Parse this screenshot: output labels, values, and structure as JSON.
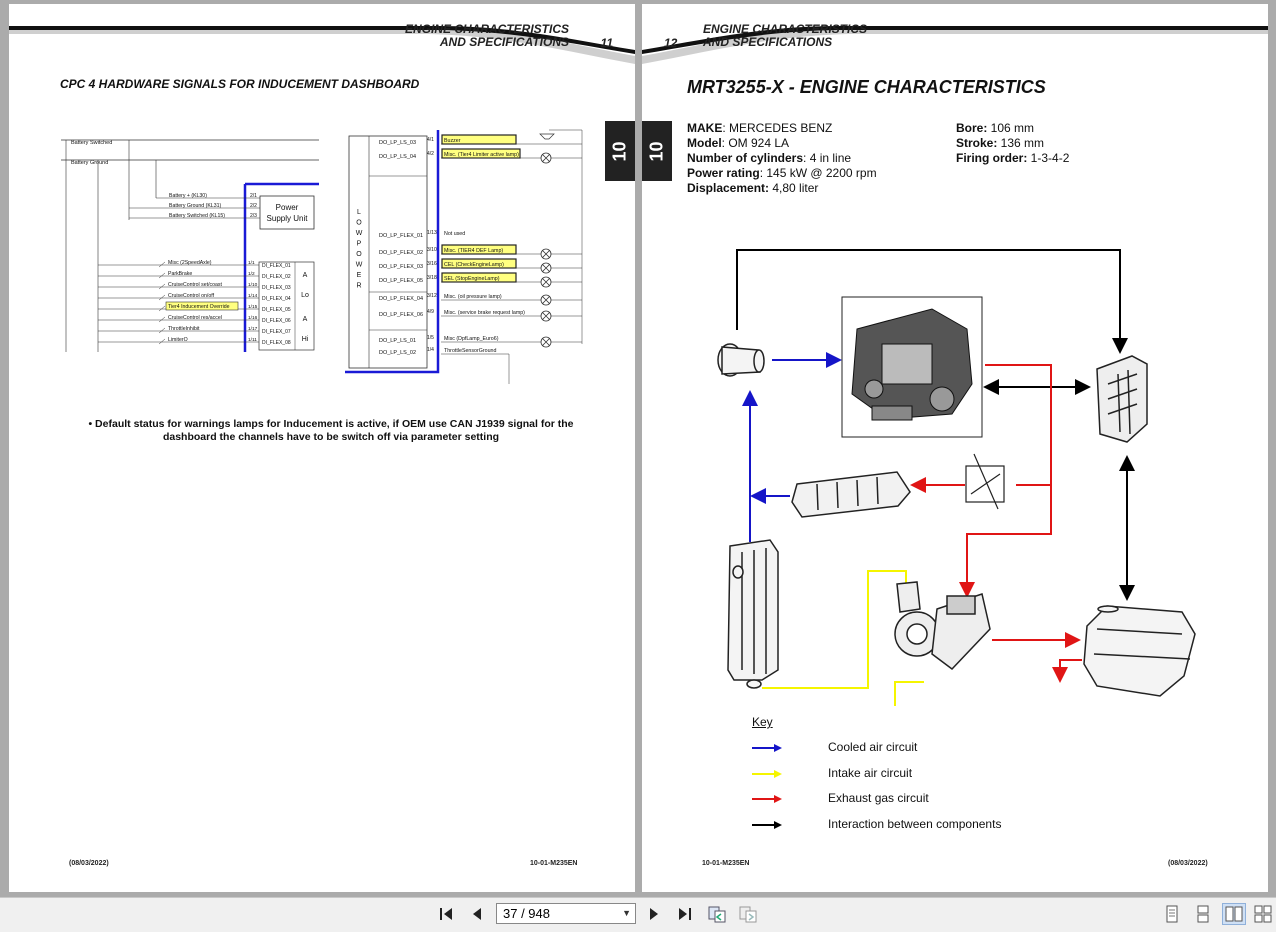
{
  "left_page": {
    "header_line1": "ENGINE CHARACTERISTICS",
    "header_line2": "AND SPECIFICATIONS",
    "page_number": "11",
    "section_tab": "10",
    "section_title": "CPC 4 HARDWARE SIGNALS FOR INDUCEMENT DASHBOARD",
    "diagram": {
      "inputs_top": [
        "Battery Switched",
        "Battery Ground"
      ],
      "psu_pins": [
        {
          "label": "Battery + (KL30)",
          "pin": "2/1"
        },
        {
          "label": "Battery Ground (KL31)",
          "pin": "2/2"
        },
        {
          "label": "Battery Switched (KL15)",
          "pin": "2/3"
        }
      ],
      "psu_label_1": "Power",
      "psu_label_2": "Supply Unit",
      "di_inputs": [
        {
          "label": "Misc (2SpeedAxle)",
          "pin": "1/1",
          "port": "DI_FLEX_01"
        },
        {
          "label": "ParkBrake",
          "pin": "1/2",
          "port": "DI_FLEX_02"
        },
        {
          "label": "CruiseControl set/coast",
          "pin": "1/10",
          "port": "DI_FLEX_03"
        },
        {
          "label": "CruiseControl on/off",
          "pin": "1/14",
          "port": "DI_FLEX_04"
        },
        {
          "label": "Tier4 Inducement Override",
          "pin": "1/15",
          "port": "DI_FLEX_05"
        },
        {
          "label": "CruiseControl res/accel",
          "pin": "1/16",
          "port": "DI_FLEX_06"
        },
        {
          "label": "ThrottleInhibit",
          "pin": "1/17",
          "port": "DI_FLEX_07"
        },
        {
          "label": "LimiterO",
          "pin": "1/11",
          "port": "DI_FLEX_08"
        }
      ],
      "group_a": "A",
      "group_lo": "Lo",
      "group_hi": "Hi",
      "low_power_letters": [
        "L",
        "O",
        "W",
        "P",
        "O",
        "W",
        "E",
        "R"
      ],
      "do_outputs": [
        {
          "port": "DO_LP_LS_03",
          "pin": "4/1",
          "label": "Buzzer"
        },
        {
          "port": "DO_LP_LS_04",
          "pin": "4/2",
          "label": "Misc. (Tier4 Limiter active lamp)"
        },
        {
          "port": "DO_LP_FLEX_01",
          "pin": "1/13",
          "label": "Not used"
        },
        {
          "port": "DO_LP_FLEX_02",
          "pin": "3/10",
          "label": "Misc. (TIER4 DEF Lamp)"
        },
        {
          "port": "DO_LP_FLEX_03",
          "pin": "3/16",
          "label": "CEL (CheckEngineLamp)"
        },
        {
          "port": "DO_LP_FLEX_05",
          "pin": "3/18",
          "label": "SEL (StopEngineLamp)"
        },
        {
          "port": "DO_LP_FLEX_04",
          "pin": "3/12",
          "label": "Misc. (oil pressure lamp)"
        },
        {
          "port": "DO_LP_FLEX_06",
          "pin": "4/9",
          "label": "Misc. (service brake request lamp)"
        },
        {
          "port": "DO_LP_LS_01",
          "pin": "1/5",
          "label": "Misc (DpfLamp_Euro6)"
        },
        {
          "port": "DO_LP_LS_02",
          "pin": "1/4",
          "label": "ThrottleSensorGround"
        }
      ],
      "highlight_color": "#ffff80",
      "bus_color": "#1a1ad6"
    },
    "note": "• Default status for warnings lamps for Inducement is active, if OEM use CAN J1939 signal for the dashboard the channels have to be switch off via parameter setting",
    "footer_date": "(08/03/2022)",
    "footer_code": "10-01-M235EN"
  },
  "right_page": {
    "header_line1": "ENGINE CHARACTERISTICS",
    "header_line2": "AND SPECIFICATIONS",
    "page_number": "12",
    "section_tab": "10",
    "title": "MRT3255-X - ENGINE CHARACTERISTICS",
    "specs_left": [
      {
        "key": "MAKE",
        "value": ": MERCEDES BENZ"
      },
      {
        "key": "Model",
        "value": ": OM 924 LA"
      },
      {
        "key": "Number of cylinders",
        "value": ": 4 in line"
      },
      {
        "key": "Power rating",
        "value": ": 145 kW @ 2200 rpm"
      },
      {
        "key": "Displacement:",
        "value": " 4,80 liter"
      }
    ],
    "specs_right": [
      {
        "key": "Bore:",
        "value": " 106 mm"
      },
      {
        "key": "Stroke:",
        "value": " 136 mm"
      },
      {
        "key": "Firing order:",
        "value": " 1-3-4-2"
      }
    ],
    "key_title": "Key",
    "key_items": [
      {
        "label": "Cooled air circuit",
        "color": "#1515c8"
      },
      {
        "label": "Intake air circuit",
        "color": "#f5f500"
      },
      {
        "label": "Exhaust gas circuit",
        "color": "#e01515"
      },
      {
        "label": "Interaction between components",
        "color": "#000000"
      }
    ],
    "footer_code": "10-01-M235EN",
    "footer_date": "(08/03/2022)"
  },
  "toolbar": {
    "page_indicator": "37 / 948",
    "icons": [
      "first-page-icon",
      "previous-page-icon",
      "next-page-icon",
      "last-page-icon",
      "go-back-icon",
      "go-forward-icon",
      "single-page-icon",
      "continuous-icon",
      "facing-pages-icon",
      "continuous-facing-icon"
    ]
  }
}
